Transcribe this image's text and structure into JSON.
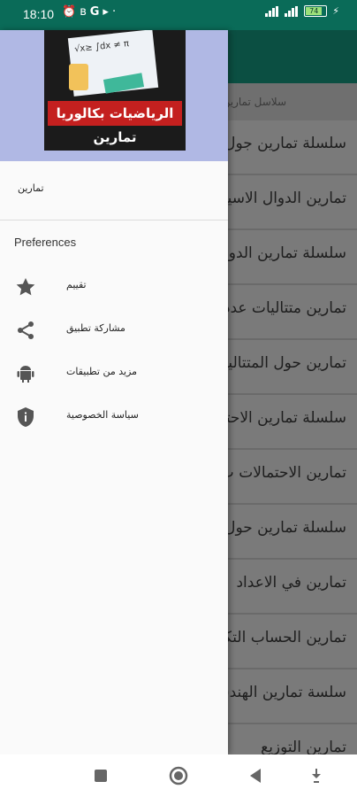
{
  "status_bar": {
    "time": "18:10",
    "left_icons": [
      "alarm-icon",
      "bluetooth-icon",
      "google-icon",
      "play-icon",
      "dot-icon"
    ],
    "battery": "74",
    "colors": {
      "background": "#0a6b58"
    }
  },
  "background_list": {
    "section_title": "سلاسل تمارين",
    "items": [
      "سلسلة تمارين جول",
      "تمارين الدوال الاسية",
      "سلسلة تمارين الدوال",
      "تمارين متتاليات عددية",
      "تمارين حول المتتاليات",
      "سلسلة تمارين الاحتمالات",
      "تمارين الاحتمالات ب",
      "سلسلة تمارين حول",
      "تمارين في الاعداد",
      "تمارين الحساب التكاملي",
      "سلسة تمارين الهندسة",
      "تمارين التوزيع"
    ]
  },
  "drawer": {
    "logo": {
      "banner": "الرياضيات بكالوريا",
      "subtitle": "تمارين"
    },
    "first_item": "تمارين",
    "preferences_header": "Preferences",
    "items": [
      {
        "label": "تقييم",
        "icon": "star-icon"
      },
      {
        "label": "مشاركة تطبيق",
        "icon": "share-icon"
      },
      {
        "label": "مزيد من تطبيقات",
        "icon": "android-icon"
      },
      {
        "label": "سياسة الخصوصية",
        "icon": "shield-icon"
      }
    ],
    "colors": {
      "header": "#b0b8e4",
      "background": "#fafafa"
    }
  },
  "nav_bar": {
    "buttons": [
      "recents-button",
      "home-button",
      "back-button",
      "keyboard-down-button"
    ]
  }
}
